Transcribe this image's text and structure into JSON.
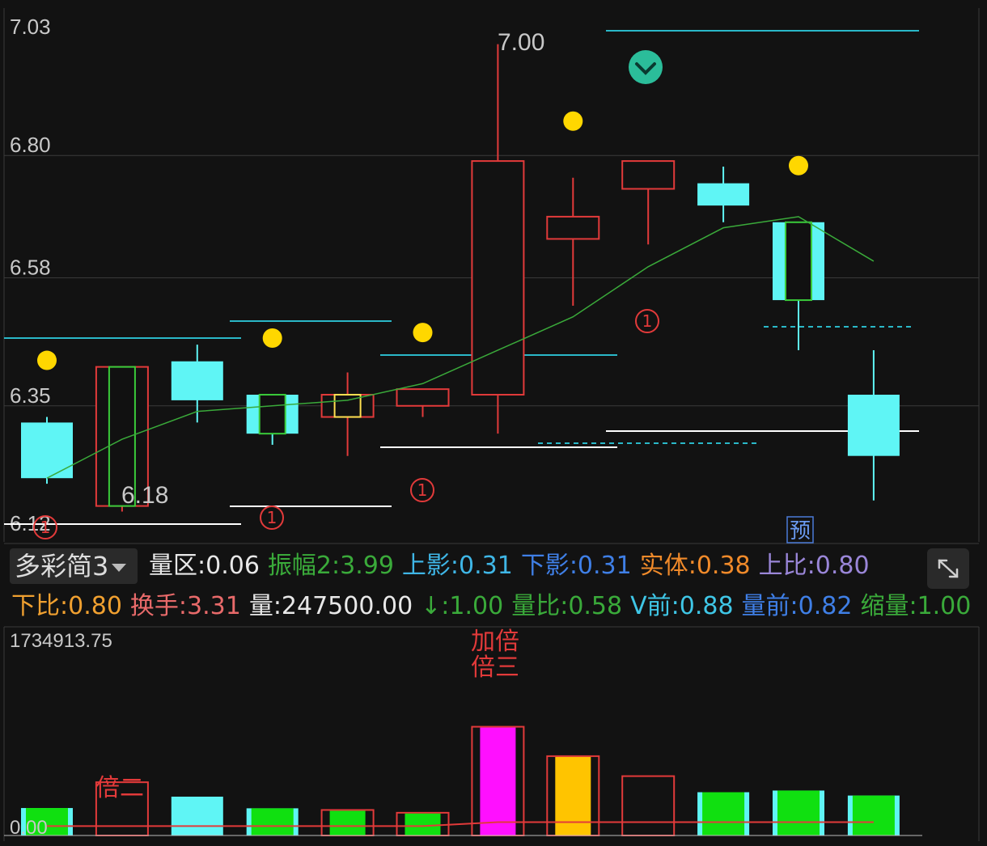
{
  "price_axis": {
    "labels": [
      "7.03",
      "6.80",
      "6.58",
      "6.35",
      "6.12"
    ]
  },
  "volume_axis": {
    "max_label": "1734913.75",
    "min_label": "0.00"
  },
  "annotations": {
    "high_label": "7.00",
    "low_label": "6.18",
    "circle_one": "1",
    "preview_badge": "预",
    "volume_tag_1": "倍二",
    "volume_tag_2": "加倍",
    "volume_tag_3": "倍三"
  },
  "toolbar": {
    "indicator_selector": "多彩简3",
    "row1": [
      {
        "key": "liang_qu",
        "label": "量区",
        "value": "0.06",
        "color": "#e8e8e8"
      },
      {
        "key": "zhenfu2",
        "label": "振幅2",
        "value": "3.99",
        "color": "#3aaa3a"
      },
      {
        "key": "shang_ying",
        "label": "上影",
        "value": "0.31",
        "color": "#3fb6e6"
      },
      {
        "key": "xia_ying",
        "label": "下影",
        "value": "0.31",
        "color": "#3f7fe6"
      },
      {
        "key": "shiti",
        "label": "实体",
        "value": "0.38",
        "color": "#f08a2a"
      },
      {
        "key": "shang_bi",
        "label": "上比",
        "value": "0.80",
        "color": "#9a86d8"
      }
    ],
    "row2": [
      {
        "key": "xia_bi",
        "label": "下比",
        "value": "0.80",
        "color": "#f0a030"
      },
      {
        "key": "huanshou",
        "label": "换手",
        "value": "3.31",
        "color": "#e86a6a"
      },
      {
        "key": "liang",
        "label": "量",
        "value": "247500.00",
        "color": "#e8e8e8"
      },
      {
        "key": "down_arrow",
        "label": "↓",
        "value": "1.00",
        "color": "#3aaa3a"
      },
      {
        "key": "liang_bi",
        "label": "量比",
        "value": "0.58",
        "color": "#3aaa3a"
      },
      {
        "key": "v_qian",
        "label": "V前",
        "value": "0.88",
        "color": "#3fc6e6"
      },
      {
        "key": "liang_qian",
        "label": "量前",
        "value": "0.82",
        "color": "#3f7fe6"
      },
      {
        "key": "suo_liang",
        "label": "缩量",
        "value": "1.00",
        "color": "#3aaa3a"
      }
    ]
  },
  "colors": {
    "background": "#121212",
    "grid": "#3a3a3a",
    "up_red": "#e23a3a",
    "down_cyan": "#5ff5f5",
    "inner_green": "#3acb3a",
    "inner_yellow": "#ffe050",
    "dot_yellow": "#ffd700",
    "ma_green": "#3aaa3a",
    "vol_green": "#10e010",
    "vol_magenta": "#ff10ff",
    "vol_orange": "#ffc400",
    "white_line": "#ffffff",
    "cyan_line": "#2ab8c8",
    "axis_text": "#c8c8c8"
  },
  "chart_data": {
    "type": "candlestick",
    "price_range": [
      6.12,
      7.03
    ],
    "candles": [
      {
        "open": 6.32,
        "close": 6.22,
        "high": 6.33,
        "low": 6.21,
        "color": "cyan",
        "inner": "none",
        "dot": true
      },
      {
        "open": 6.17,
        "close": 6.42,
        "high": 6.42,
        "low": 6.16,
        "color": "red",
        "inner": "green",
        "dot": false
      },
      {
        "open": 6.43,
        "close": 6.36,
        "high": 6.46,
        "low": 6.32,
        "color": "cyan",
        "inner": "none",
        "dot": false
      },
      {
        "open": 6.37,
        "close": 6.3,
        "high": 6.37,
        "low": 6.28,
        "color": "cyan",
        "inner": "green",
        "dot": true
      },
      {
        "open": 6.33,
        "close": 6.37,
        "high": 6.41,
        "low": 6.26,
        "color": "red",
        "inner": "yellow",
        "dot": false
      },
      {
        "open": 6.35,
        "close": 6.38,
        "high": 6.38,
        "low": 6.33,
        "color": "red",
        "inner": "none",
        "dot": true
      },
      {
        "open": 6.37,
        "close": 6.79,
        "high": 7.0,
        "low": 6.3,
        "color": "red",
        "inner": "none",
        "dot": false
      },
      {
        "open": 6.65,
        "close": 6.69,
        "high": 6.76,
        "low": 6.53,
        "color": "red",
        "inner": "none",
        "dot": true
      },
      {
        "open": 6.74,
        "close": 6.79,
        "high": 6.79,
        "low": 6.64,
        "color": "red",
        "inner": "none",
        "dot": false
      },
      {
        "open": 6.75,
        "close": 6.71,
        "high": 6.78,
        "low": 6.68,
        "color": "cyan",
        "inner": "none",
        "dot": false
      },
      {
        "open": 6.68,
        "close": 6.54,
        "high": 6.68,
        "low": 6.45,
        "color": "cyan",
        "inner": "green",
        "dot": true
      },
      {
        "open": 6.37,
        "close": 6.26,
        "high": 6.45,
        "low": 6.18,
        "color": "cyan",
        "inner": "none",
        "dot": false
      }
    ],
    "moving_average": [
      6.22,
      6.29,
      6.34,
      6.35,
      6.36,
      6.39,
      6.45,
      6.51,
      6.6,
      6.67,
      6.69,
      6.61
    ],
    "volume_range": [
      0,
      1734913.75
    ],
    "volumes": [
      {
        "value": 247500,
        "fill": "green",
        "outline": "cyan"
      },
      {
        "value": 480000,
        "fill": "none",
        "outline": "red"
      },
      {
        "value": 350000,
        "fill": "cyan",
        "outline": "cyan"
      },
      {
        "value": 245000,
        "fill": "green",
        "outline": "cyan"
      },
      {
        "value": 230000,
        "fill": "green",
        "outline": "red"
      },
      {
        "value": 205000,
        "fill": "green",
        "outline": "red"
      },
      {
        "value": 980000,
        "fill": "magenta",
        "outline": "red"
      },
      {
        "value": 715000,
        "fill": "orange",
        "outline": "red"
      },
      {
        "value": 535000,
        "fill": "none",
        "outline": "red"
      },
      {
        "value": 390000,
        "fill": "green",
        "outline": "cyan"
      },
      {
        "value": 405000,
        "fill": "green",
        "outline": "cyan"
      },
      {
        "value": 360000,
        "fill": "green",
        "outline": "cyan"
      }
    ],
    "volume_ma": [
      85000,
      85000,
      85000,
      85000,
      85000,
      85000,
      120000,
      120000,
      120000,
      120000,
      120000,
      120000
    ]
  }
}
